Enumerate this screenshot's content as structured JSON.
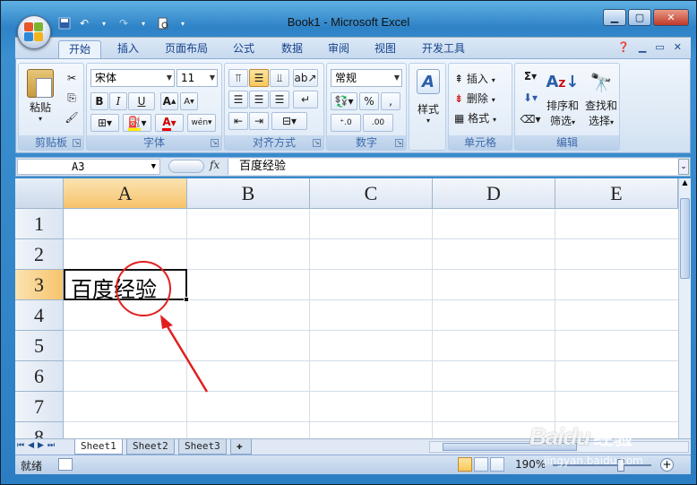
{
  "window": {
    "title": "Book1 - Microsoft Excel"
  },
  "tabs": [
    {
      "label": "开始",
      "active": true
    },
    {
      "label": "插入"
    },
    {
      "label": "页面布局"
    },
    {
      "label": "公式"
    },
    {
      "label": "数据"
    },
    {
      "label": "审阅"
    },
    {
      "label": "视图"
    },
    {
      "label": "开发工具"
    }
  ],
  "ribbon": {
    "clipboard": {
      "group_label": "剪贴板",
      "paste_label": "粘贴"
    },
    "font": {
      "group_label": "字体",
      "font_name": "宋体",
      "font_size": "11",
      "bold": "B",
      "italic": "I",
      "underline": "U"
    },
    "alignment": {
      "group_label": "对齐方式"
    },
    "number": {
      "group_label": "数字",
      "format": "常规",
      "percent": "%",
      "comma": ","
    },
    "styles": {
      "label": "样式"
    },
    "cells": {
      "group_label": "单元格",
      "insert": "插入",
      "delete": "删除",
      "format": "格式"
    },
    "editing": {
      "group_label": "编辑",
      "sort_line1": "排序和",
      "sort_line2": "筛选",
      "find_line1": "查找和",
      "find_line2": "选择"
    }
  },
  "formula_bar": {
    "name_box": "A3",
    "fx": "fx",
    "content": "百度经验"
  },
  "grid": {
    "columns": [
      "A",
      "B",
      "C",
      "D",
      "E"
    ],
    "rows": [
      "1",
      "2",
      "3",
      "4",
      "5",
      "6",
      "7",
      "8"
    ],
    "selected_column": "A",
    "selected_row": "3",
    "cell_a3": "百度经验"
  },
  "sheets": [
    {
      "name": "Sheet1",
      "active": true
    },
    {
      "name": "Sheet2"
    },
    {
      "name": "Sheet3"
    }
  ],
  "status": {
    "text": "就绪",
    "zoom": "190%"
  },
  "watermark": {
    "logo": "Baidu",
    "cn": "经验",
    "url": "jingyan.baidu.com"
  },
  "colors": {
    "accent": "#f7c36b",
    "ribbon_text": "#15428b",
    "annotation": "#e0201f"
  }
}
